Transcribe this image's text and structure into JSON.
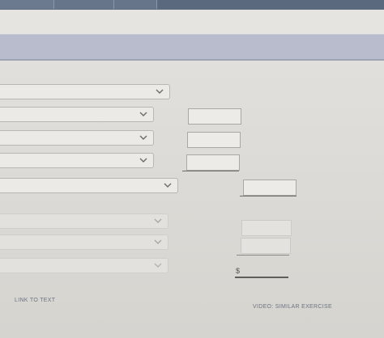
{
  "top_nav": {
    "tabs": [
      "",
      "",
      "",
      ""
    ]
  },
  "currency_symbol": "$",
  "links": {
    "link_to_text": "LINK TO TEXT",
    "video_similar_exercise": "VIDEO: SIMILAR EXERCISE"
  },
  "colors": {
    "top_bar": "#5f6e83",
    "section_bar": "#b9bccc",
    "link_text": "#6b7280"
  },
  "icons": {
    "select_chevron": "chevron-down-icon"
  }
}
